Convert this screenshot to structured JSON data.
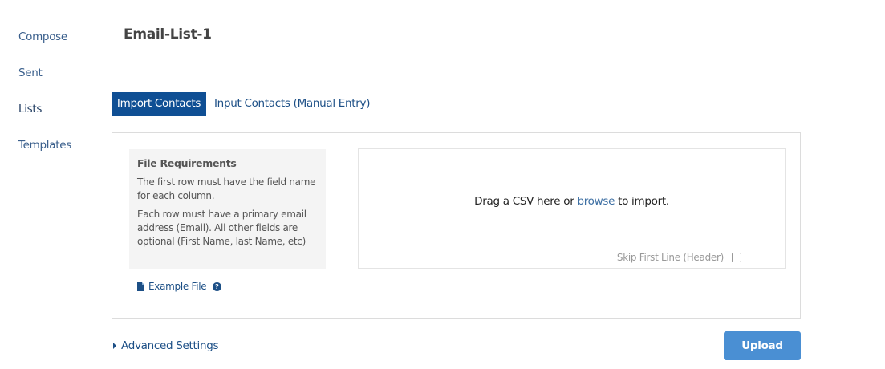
{
  "sidebar": {
    "items": [
      {
        "label": "Compose",
        "active": false
      },
      {
        "label": "Sent",
        "active": false
      },
      {
        "label": "Lists",
        "active": true
      },
      {
        "label": "Templates",
        "active": false
      }
    ]
  },
  "list": {
    "title": "Email-List-1"
  },
  "tabs": [
    {
      "label": "Import Contacts",
      "active": true
    },
    {
      "label": "Input Contacts (Manual Entry)",
      "active": false
    }
  ],
  "requirements": {
    "title": "File Requirements",
    "line1": "The first row must have the field name for each column.",
    "line2": "Each row must have a primary email address (Email). All other fields are optional (First Name, last Name, etc)"
  },
  "example_file": {
    "label": "Example File",
    "icon": "file-icon",
    "help_icon": "question-circle-icon"
  },
  "dropzone": {
    "text_before": "Drag a CSV here or ",
    "link": "browse",
    "text_after": " to import.",
    "skip_label": "Skip First Line (Header)",
    "skip_checked": false
  },
  "advanced": {
    "label": "Advanced Settings",
    "icon": "caret-right-icon"
  },
  "upload": {
    "label": "Upload"
  },
  "colors": {
    "tab_active_bg": "#0f4f94",
    "link": "#1c4f86",
    "button": "#4a8fd3"
  }
}
